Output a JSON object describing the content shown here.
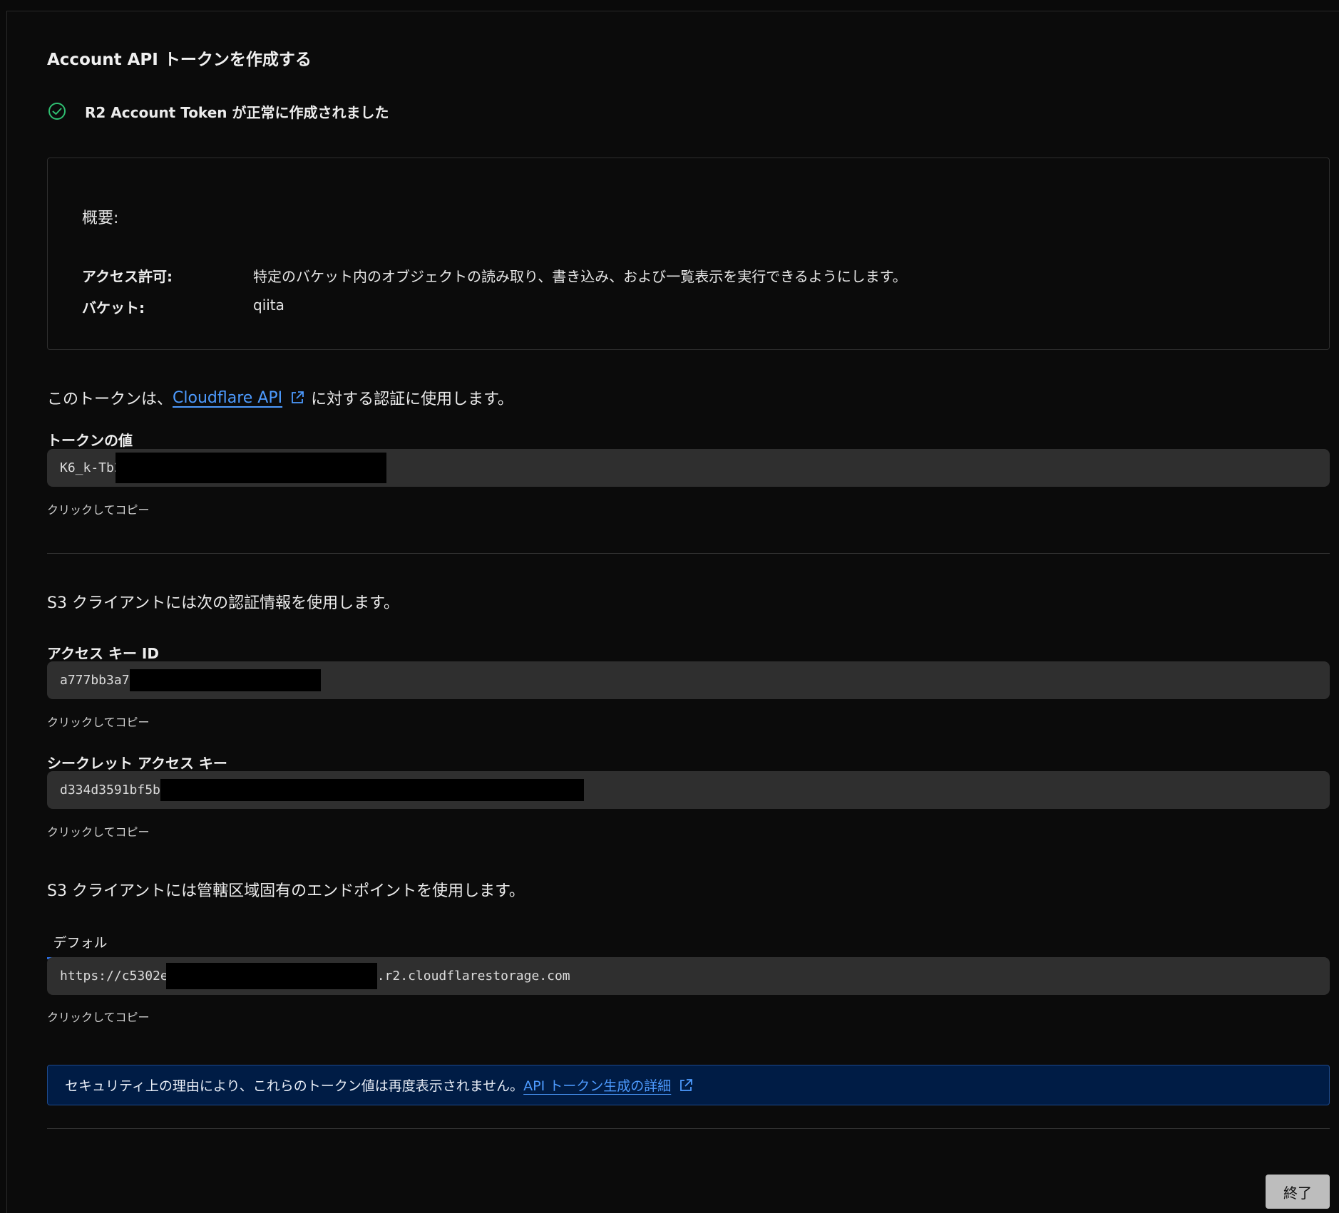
{
  "header": {
    "title": "Account API トークンを作成する"
  },
  "status": {
    "success_message": "R2 Account Token が正常に作成されました",
    "icon": "check-circle-icon",
    "color": "#2fbf71"
  },
  "summary": {
    "heading": "概要:",
    "rows": [
      {
        "key": "アクセス許可:",
        "value": "特定のバケット内のオブジェクトの読み取り、書き込み、および一覧表示を実行できるようにします。"
      },
      {
        "key": "バケット:",
        "value": "qiita"
      }
    ]
  },
  "token_usage": {
    "prefix": "このトークンは、",
    "link": "Cloudflare API",
    "suffix": "に対する認証に使用します。"
  },
  "token_value": {
    "label": "トークンの値",
    "value": "K6_k-Tb2",
    "hint": "クリックしてコピー"
  },
  "s3_credentials": {
    "intro": "S3 クライアントには次の認証情報を使用します。",
    "access_key": {
      "label": "アクセス キー ID",
      "value": "a777bb3a7",
      "hint": "クリックしてコピー"
    },
    "secret_key": {
      "label": "シークレット アクセス キー",
      "value": "d334d3591bf5b",
      "hint": "クリックしてコピー"
    }
  },
  "endpoint": {
    "intro": "S3 クライアントには管轄区域固有のエンドポイントを使用します。",
    "tab": "デフォルト",
    "value_prefix": "https://c5302e",
    "value_suffix": ".r2.cloudflarestorage.com",
    "hint": "クリックしてコピー"
  },
  "notice": {
    "text": "セキュリティ上の理由により、これらのトークン値は再度表示されません。",
    "link": "API トークン生成の詳細",
    "background": "#001c45"
  },
  "footer": {
    "finish_label": "終了"
  },
  "colors": {
    "link": "#4d9bff",
    "tab_underline": "#2a6de0"
  }
}
